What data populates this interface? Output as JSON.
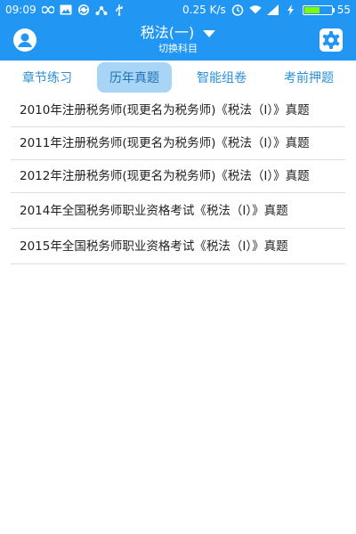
{
  "status_bar": {
    "time": "09:09",
    "network_speed": "0.25 K/s",
    "battery": "55",
    "battery_level_percent": 55,
    "icons": [
      "infinity-icon",
      "image-icon",
      "sync-icon",
      "network-icon",
      "usb-icon",
      "alarm-icon",
      "wifi-icon",
      "signal-icon",
      "charging-icon",
      "battery-icon"
    ]
  },
  "header": {
    "title": "税法(一)",
    "subtitle": "切换科目",
    "left_icon": "user-avatar-icon",
    "right_icon": "gear-icon",
    "accent_color": "#2196f3"
  },
  "tabs": [
    {
      "label": "章节练习",
      "active": false
    },
    {
      "label": "历年真题",
      "active": true
    },
    {
      "label": "智能组卷",
      "active": false
    },
    {
      "label": "考前押题",
      "active": false
    }
  ],
  "exams": [
    {
      "title": "2010年注册税务师(现更名为税务师)《税法（I）》真题"
    },
    {
      "title": "2011年注册税务师(现更名为税务师)《税法（I）》真题"
    },
    {
      "title": "2012年注册税务师(现更名为税务师)《税法（I）》真题"
    },
    {
      "title": "2014年全国税务师职业资格考试《税法（I）》真题"
    },
    {
      "title": "2015年全国税务师职业资格考试《税法（I）》真题"
    }
  ]
}
